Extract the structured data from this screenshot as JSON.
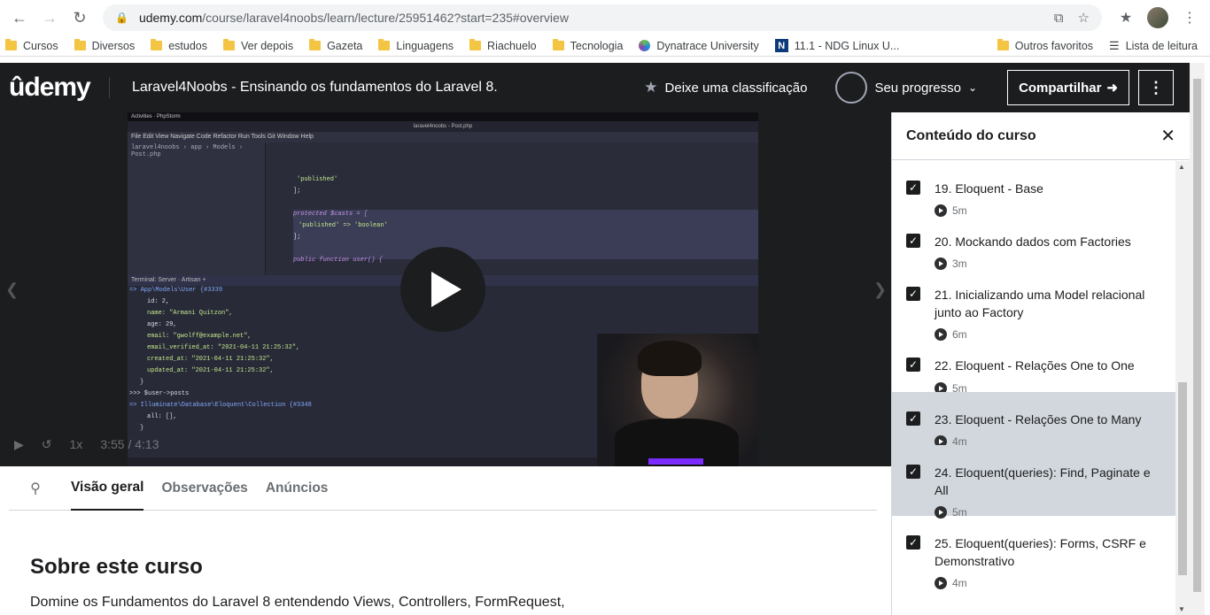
{
  "browser": {
    "url_host": "udemy.com",
    "url_path": "/course/laravel4noobs/learn/lecture/25951462?start=235#overview",
    "bookmarks": [
      "Cursos",
      "Diversos",
      "estudos",
      "Ver depois",
      "Gazeta",
      "Linguagens",
      "Riachuelo",
      "Tecnologia",
      "Dynatrace University",
      "11.1 - NDG Linux U..."
    ],
    "other_favorites": "Outros favoritos",
    "reading_list": "Lista de leitura"
  },
  "header": {
    "logo": "ûdemy",
    "course_title": "Laravel4Noobs - Ensinando os fundamentos do Laravel 8.",
    "rate_label": "Deixe uma classificação",
    "progress_label": "Seu progresso",
    "share_label": "Compartilhar",
    "more_label": "⋮"
  },
  "tabs": {
    "items": [
      "Visão geral",
      "Observações",
      "Anúncios"
    ]
  },
  "about": {
    "title": "Sobre este curso",
    "text": "Domine os Fundamentos do Laravel 8 entendendo Views, Controllers, FormRequest,"
  },
  "sidebar": {
    "title": "Conteúdo do curso",
    "lectures": [
      {
        "title": "19. Eloquent - Base",
        "duration": "5m",
        "active": false
      },
      {
        "title": "20. Mockando dados com Factories",
        "duration": "3m",
        "active": false
      },
      {
        "title": "21. Inicializando uma Model relacional junto ao Factory",
        "duration": "6m",
        "active": false
      },
      {
        "title": "22. Eloquent - Relações One to One",
        "duration": "5m",
        "active": false
      },
      {
        "title": "23. Eloquent - Relações One to Many",
        "duration": "4m",
        "active": true
      },
      {
        "title": "24. Eloquent(queries): Find, Paginate e All",
        "duration": "5m",
        "active": true
      },
      {
        "title": "25. Eloquent(queries): Forms, CSRF e Demonstrativo",
        "duration": "4m",
        "active": false
      }
    ]
  },
  "video": {
    "ide_window_title": "laravel4noobs - Post.php",
    "breadcrumb": "laravel4noobs › app › Models › Post.php",
    "code": [
      "'published'",
      "];",
      "protected $casts = [",
      "'published' => 'boolean'",
      "];",
      "public function user() {"
    ],
    "terminal": [
      "=> App\\Models\\User {#3339",
      "id: 2,",
      "name: \"Armani Quitzon\",",
      "age: 29,",
      "email: \"gwolff@example.net\",",
      "email_verified_at: \"2021-04-11 21:25:32\",",
      "created_at: \"2021-04-11 21:25:32\",",
      "updated_at: \"2021-04-11 21:25:32\",",
      "}",
      ">>> $user->posts",
      "=> Illuminate\\Database\\Eloquent\\Collection {#3348",
      "all: [],",
      "}"
    ],
    "time": "3:55 / 4:13",
    "speed": "1x"
  }
}
